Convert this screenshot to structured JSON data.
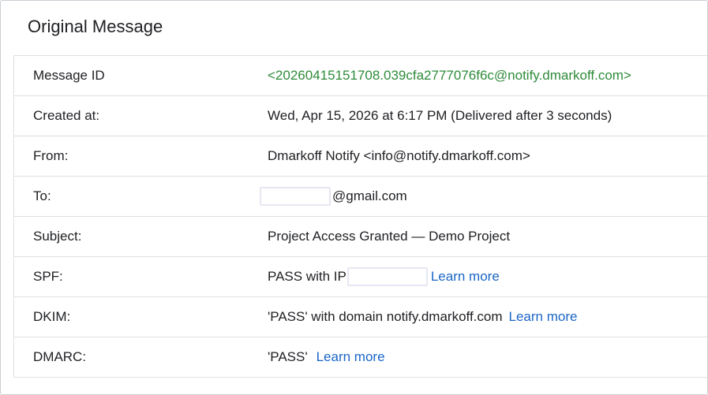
{
  "page": {
    "title": "Original Message"
  },
  "rows": {
    "message_id": {
      "label": "Message ID",
      "value": "<20260415151708.039cfa2777076f6c@notify.dmarkoff.com>"
    },
    "created_at": {
      "label": "Created at:",
      "value": "Wed, Apr 15, 2026 at 6:17 PM (Delivered after 3 seconds)"
    },
    "from": {
      "label": "From:",
      "value": "Dmarkoff Notify <info@notify.dmarkoff.com>"
    },
    "to": {
      "label": "To:",
      "value_suffix": "@gmail.com"
    },
    "subject": {
      "label": "Subject:",
      "value": "Project Access Granted — Demo Project"
    },
    "spf": {
      "label": "SPF:",
      "value_prefix": "PASS with IP",
      "learn_more": "Learn more"
    },
    "dkim": {
      "label": "DKIM:",
      "value": "'PASS' with domain notify.dmarkoff.com",
      "learn_more": "Learn more"
    },
    "dmarc": {
      "label": "DMARC:",
      "value": "'PASS'",
      "learn_more": "Learn more"
    }
  },
  "colors": {
    "message_id": "#2e8b3a",
    "link": "#1a66c7",
    "text": "#202124",
    "border": "#e0e0e0"
  }
}
